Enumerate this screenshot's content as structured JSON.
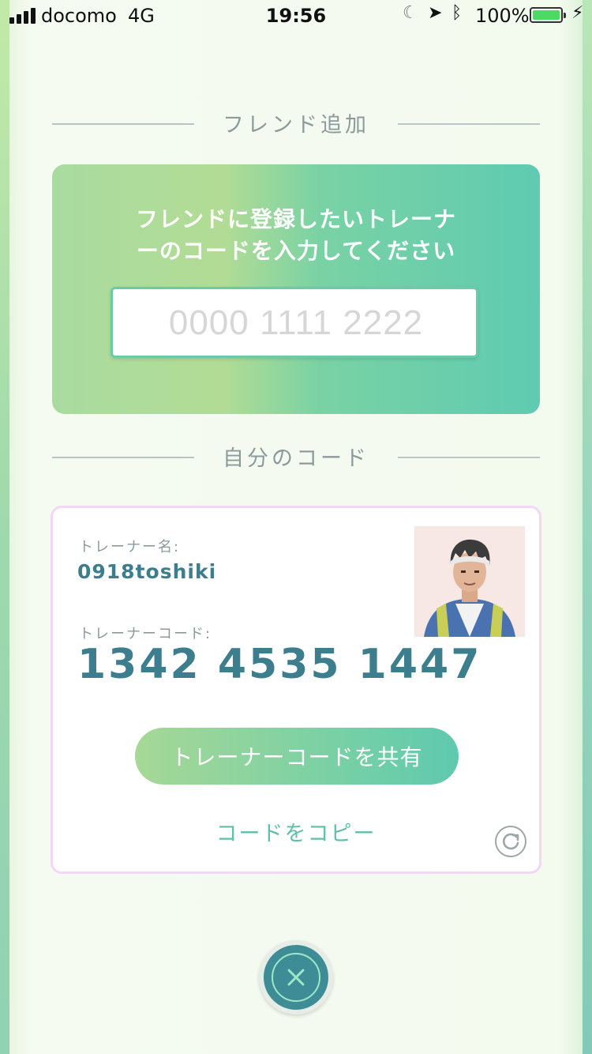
{
  "status_bar": {
    "carrier": "docomo",
    "network": "4G",
    "time": "19:56",
    "battery_percent": "100%",
    "icons": [
      "signal-icon",
      "moon-icon",
      "location-arrow-icon",
      "bluetooth-icon",
      "battery-icon",
      "charging-bolt-icon"
    ]
  },
  "add_friend": {
    "section_title": "フレンド追加",
    "prompt_line1": "フレンドに登録したいトレーナ",
    "prompt_line2": "ーのコードを入力してください",
    "code_input": {
      "placeholder": "0000 1111 2222",
      "value": ""
    }
  },
  "my_code": {
    "section_title": "自分のコード",
    "trainer_name_label": "トレーナー名:",
    "trainer_name": "0918toshiki",
    "trainer_code_label": "トレーナーコード:",
    "trainer_code": "1342 4535 1447",
    "share_button": "トレーナーコードを共有",
    "copy_link": "コードをコピー",
    "refresh_icon": "refresh-icon"
  },
  "close_button": {
    "icon": "close-icon"
  },
  "colors": {
    "accent_teal": "#3c7d8e",
    "copy_green": "#5fbfa8",
    "close_bg": "#3e8c95"
  }
}
